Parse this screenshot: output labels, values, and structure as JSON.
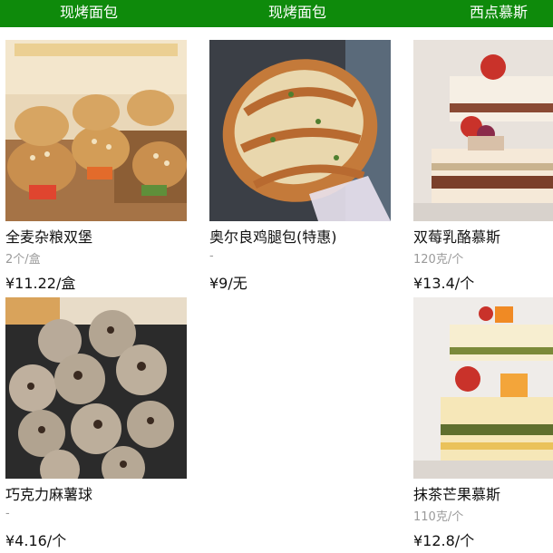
{
  "categories": [
    {
      "label": "现烤面包"
    },
    {
      "label": "现烤面包"
    },
    {
      "label": "西点慕斯"
    }
  ],
  "columns": [
    {
      "products": [
        {
          "name": "全麦杂粮双堡",
          "spec": "2个/盒",
          "price": "¥11.22/盒",
          "image": "sandwich-buns-photo"
        },
        {
          "name": "巧克力麻薯球",
          "spec": "-",
          "price": "¥4.16/个",
          "image": "chocolate-mochi-balls-photo"
        }
      ]
    },
    {
      "products": [
        {
          "name": "奥尔良鸡腿包(特惠)",
          "spec": "-",
          "price": "¥9/无",
          "image": "orleans-chicken-bun-photo"
        }
      ]
    },
    {
      "products": [
        {
          "name": "双莓乳酪慕斯",
          "spec": "120克/个",
          "price": "¥13.4/个",
          "image": "berry-cheese-mousse-photo"
        },
        {
          "name": "抹茶芒果慕斯",
          "spec": "110克/个",
          "price": "¥12.8/个",
          "image": "matcha-mango-mousse-photo"
        }
      ]
    }
  ],
  "colors": {
    "header_bg": "#0e8a0b",
    "header_text": "#ffffff",
    "spec_text": "#9a9a9a"
  }
}
